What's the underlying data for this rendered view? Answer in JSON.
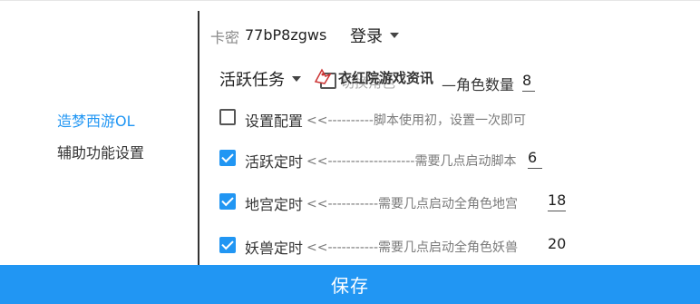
{
  "sidebar": {
    "title": "造梦西游OL",
    "subtitle": "辅助功能设置"
  },
  "login": {
    "card_label": "卡密",
    "card_value": "77bP8zgws",
    "button_label": "登录"
  },
  "task_row": {
    "mode_select": "活跃任务",
    "hidden_option": "切换角色",
    "role_count_label": "—角色数量",
    "role_count_value": "8"
  },
  "overlay": {
    "logo_text": "衣红院游戏资讯"
  },
  "settings": [
    {
      "label": "设置配置",
      "checked": false,
      "hint": "<<----------脚本使用初，设置一次即可",
      "value": ""
    },
    {
      "label": "活跃定时",
      "checked": true,
      "hint": "<<-------------------需要几点启动脚本",
      "value": "6"
    },
    {
      "label": "地宫定时",
      "checked": true,
      "hint": "<<-----------需要几点启动全角色地宫",
      "value": "18"
    },
    {
      "label": "妖兽定时",
      "checked": true,
      "hint": "<<-----------需要几点启动全角色妖兽",
      "value": "20"
    }
  ],
  "footer": {
    "save_label": "保存"
  },
  "colors": {
    "accent": "#2196F3"
  }
}
